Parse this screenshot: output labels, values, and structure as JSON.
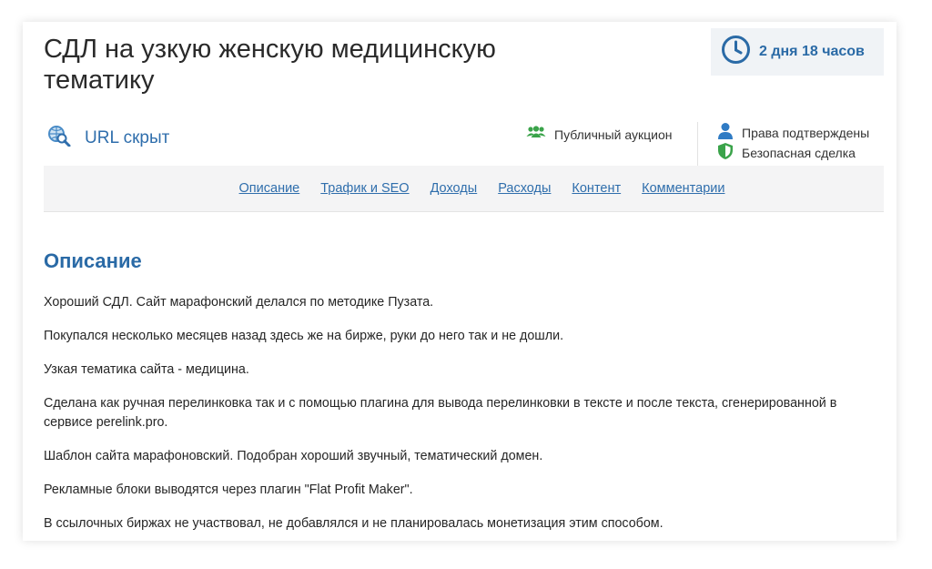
{
  "listing": {
    "title": "СДЛ на узкую женскую медицинскую тематику",
    "timer": {
      "icon": "clock-icon",
      "text": "2 дня 18 часов"
    },
    "url": {
      "icon": "globe-search-icon",
      "text": "URL скрыт"
    },
    "auction": {
      "icon": "users-icon",
      "text": "Публичный аукцион"
    },
    "trust": [
      {
        "icon": "user-icon",
        "text": "Права подтверждены"
      },
      {
        "icon": "shield-icon",
        "text": "Безопасная сделка"
      }
    ]
  },
  "tabs": [
    {
      "label": "Описание"
    },
    {
      "label": "Трафик и SEO"
    },
    {
      "label": "Доходы"
    },
    {
      "label": "Расходы"
    },
    {
      "label": "Контент"
    },
    {
      "label": "Комментарии"
    }
  ],
  "description": {
    "heading": "Описание",
    "paragraphs": [
      "Хороший СДЛ. Сайт марафонский делался по методике Пузата.",
      "Покупался несколько месяцев назад здесь же на бирже, руки до него так и не дошли.",
      "Узкая тематика сайта - медицина.",
      "Сделана как ручная перелинковка так и с помощью плагина для вывода перелинковки в тексте и после текста, сгенерированной в сервисе perelink.pro.",
      "Шаблон сайта марафоновский. Подобран хороший звучный, тематический домен.",
      "Рекламные блоки выводятся через плагин \"Flat Profit Maker\".",
      "В ссылочных биржах не участвовал, не добавлялся и не планировалась монетизация этим способом."
    ]
  },
  "colors": {
    "accent": "#2a6aa6",
    "link": "#2f6eac",
    "green": "#3aa34a",
    "tabs_background": "#f4f4f5"
  }
}
